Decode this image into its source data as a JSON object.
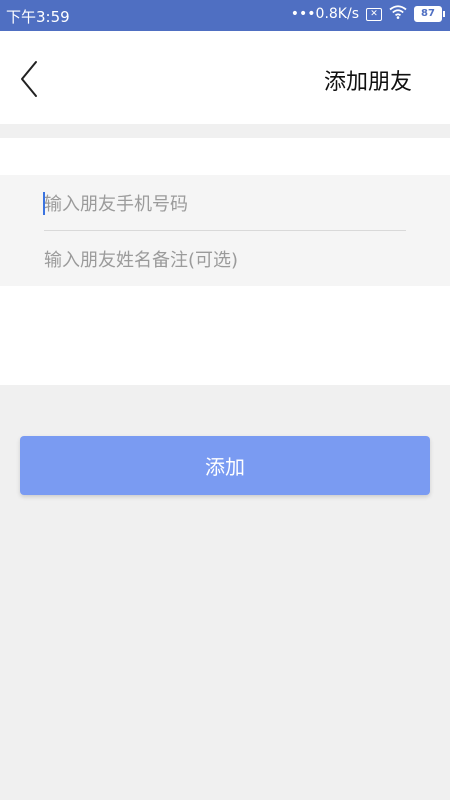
{
  "status_bar": {
    "time": "下午3:59",
    "network_speed": "•••0.8K/s",
    "sim_icon": "sim-disabled-icon",
    "wifi_icon": "wifi-icon",
    "battery_level": "87"
  },
  "header": {
    "back_icon": "chevron-left-icon",
    "title": "添加朋友"
  },
  "form": {
    "phone_placeholder": "输入朋友手机号码",
    "phone_value": "",
    "remark_placeholder": "输入朋友姓名备注(可选)",
    "remark_value": ""
  },
  "actions": {
    "add_label": "添加"
  },
  "colors": {
    "status_bar": "#4f6fc2",
    "primary_button": "#7a9bf2",
    "cursor": "#3a73e0"
  }
}
